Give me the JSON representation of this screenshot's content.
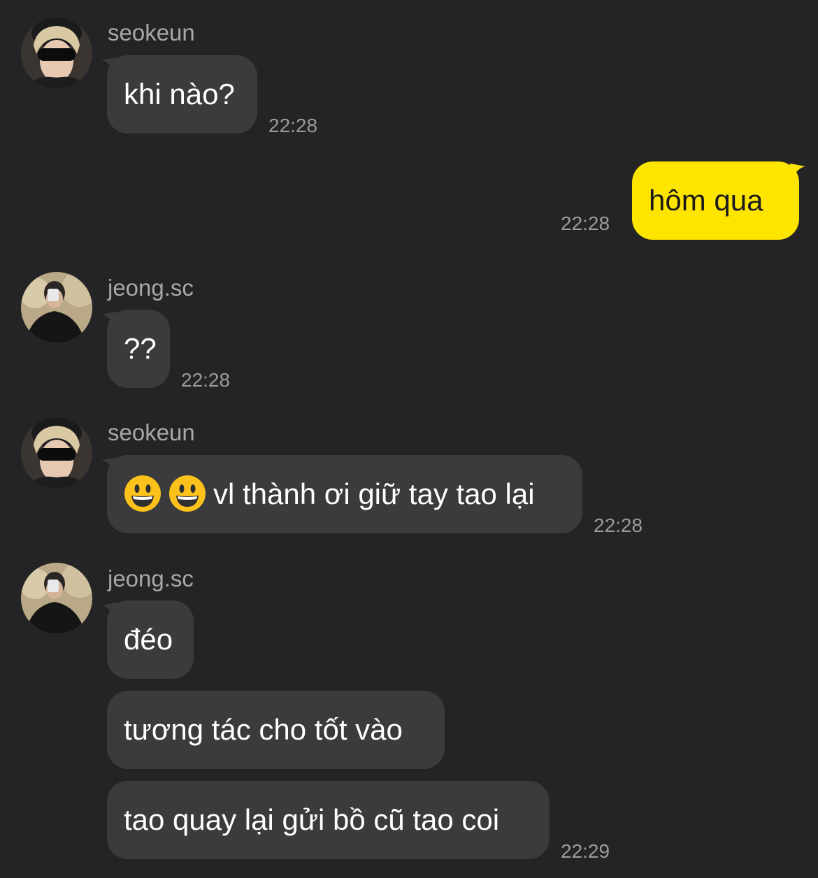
{
  "colors": {
    "background": "#242426",
    "bubble_other": "#3b3b3d",
    "bubble_me": "#fee500",
    "text_other": "#ffffff",
    "text_me": "#1b1b1b",
    "meta_text": "#9b9b9e"
  },
  "messages": [
    {
      "sender": "seokeun",
      "text": "khi nào?",
      "time": "22:28"
    },
    {
      "sender": "me",
      "text": "hôm qua",
      "time": "22:28"
    },
    {
      "sender": "jeong.sc",
      "text": "??",
      "time": "22:28"
    },
    {
      "sender": "seokeun",
      "emoji": [
        "grinning-face-icon",
        "grinning-face-icon"
      ],
      "text": "vl thành ơi giữ tay tao lại",
      "time": "22:28"
    },
    {
      "sender": "jeong.sc",
      "text": "đéo"
    },
    {
      "sender": "jeong.sc",
      "text": "tương tác cho tốt vào"
    },
    {
      "sender": "jeong.sc",
      "text": "tao quay lại gửi bồ cũ tao coi",
      "time": "22:29"
    }
  ]
}
